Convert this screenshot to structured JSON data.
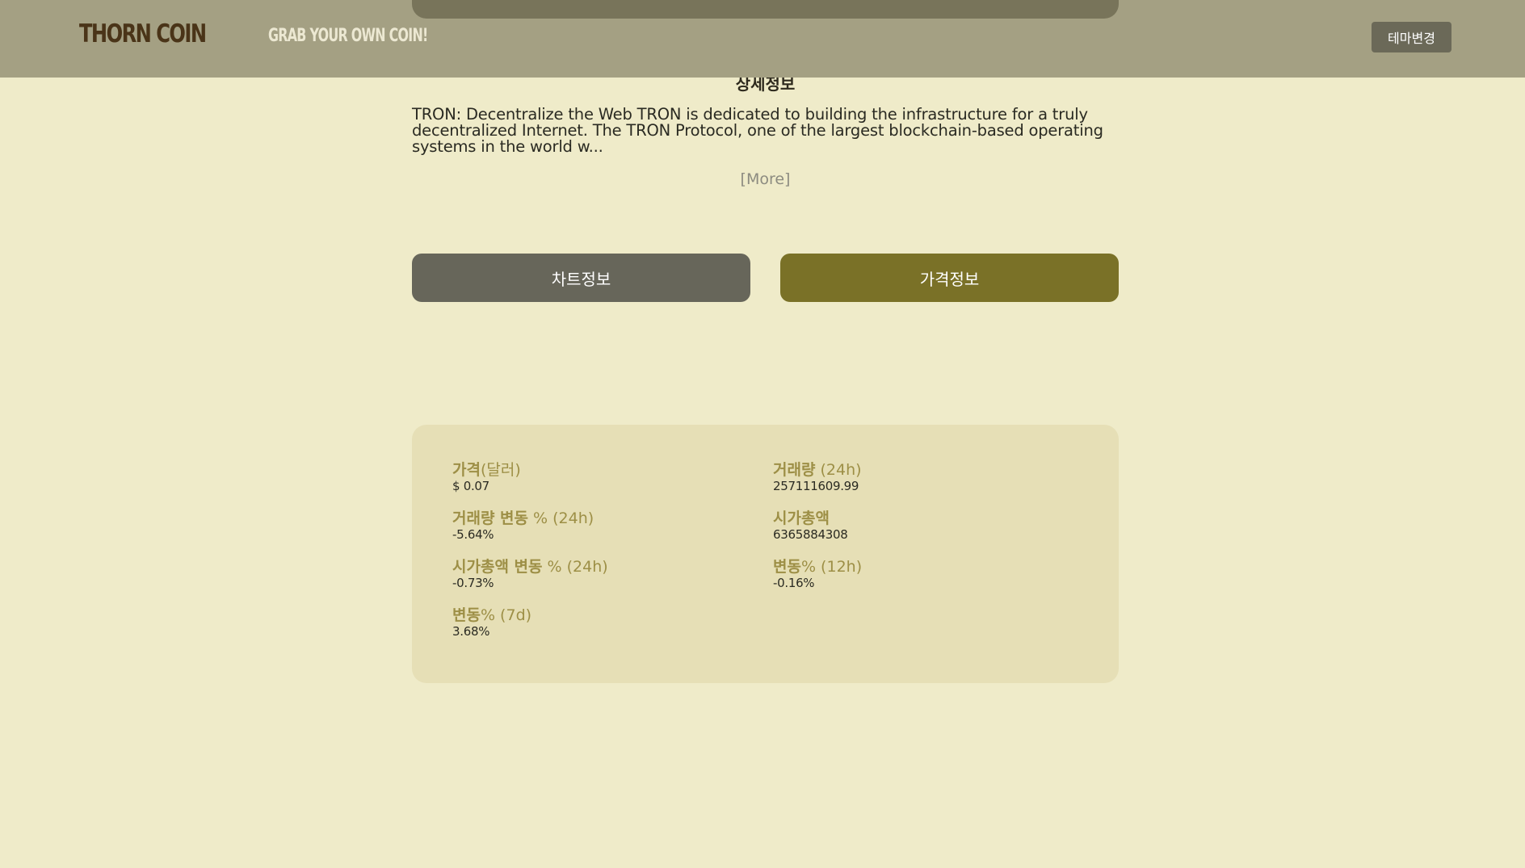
{
  "header": {
    "logo": "THORN COIN",
    "tagline": "GRAB YOUR OWN COIN!",
    "theme_button": "테마변경"
  },
  "detail": {
    "title": "상세정보",
    "description": "TRON: Decentralize the Web TRON is dedicated to building the infrastructure for a truly decentralized Internet. The TRON Protocol, one of the largest blockchain-based operating systems in the world w...",
    "more": "[More]"
  },
  "tabs": {
    "chart": "차트정보",
    "price": "가격정보"
  },
  "stats": {
    "price": {
      "label_ko": "가격",
      "label_suffix": "(달러)",
      "value": "$ 0.07"
    },
    "volume_24h": {
      "label_ko": "거래량",
      "label_suffix": " (24h)",
      "value": "257111609.99"
    },
    "volume_change_24h": {
      "label_ko": "거래량 변동",
      "label_suffix": " % (24h)",
      "value": "-5.64%"
    },
    "market_cap": {
      "label_ko": "시가총액",
      "label_suffix": "",
      "value": "6365884308"
    },
    "market_cap_change_24h": {
      "label_ko": "시가총액 변동",
      "label_suffix": " % (24h)",
      "value": "-0.73%"
    },
    "change_12h": {
      "label_ko": "변동",
      "label_suffix": "% (12h)",
      "value": "-0.16%"
    },
    "change_7d": {
      "label_ko": "변동",
      "label_suffix": "% (7d)",
      "value": "3.68%"
    }
  },
  "colors": {
    "background": "#efebc9",
    "header": "#a4a083",
    "chart_tab": "#67665a",
    "price_tab": "#7a7127",
    "stat_label": "#9d8f46"
  }
}
